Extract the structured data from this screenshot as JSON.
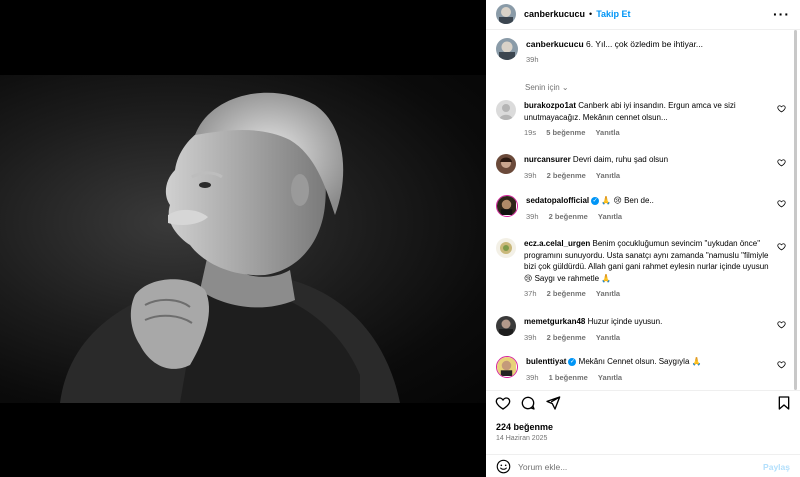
{
  "post": {
    "username": "canberkucucu",
    "dot": "•",
    "follow_label": "Takip Et",
    "more_label": "···",
    "caption": " 6. Yıl... çok özledim be ihtiyar...",
    "caption_time": "39h"
  },
  "sort_label": "Senin için ⌄",
  "comments": [
    {
      "username": "burakozpo1at",
      "text": " Canberk abi iyi insandın. Ergun amca ve sizi unutmayacağız. Mekânın cennet olsun...",
      "time": "19s",
      "likes": "5 beğenme",
      "reply": "Yanıtla"
    },
    {
      "username": "nurcansurer",
      "text": " Devri daim, ruhu şad olsun",
      "time": "39h",
      "likes": "2 beğenme",
      "reply": "Yanıtla"
    },
    {
      "username": "sedatopalofficial",
      "text": " 🙏 😢  Ben de..",
      "time": "39h",
      "likes": "2 beğenme",
      "reply": "Yanıtla"
    },
    {
      "username": "ecz.a.celal_urgen",
      "text": " Benim çocukluğumun sevincim \"uykudan önce\" programını sunuyordu. Usta sanatçı aynı zamanda \"namuslu \"filmiyle bizi çok güldürdü. Allah gani gani rahmet eylesin nurlar içinde uyusun 😢  Saygı ve rahmetle 🙏",
      "time": "37h",
      "likes": "2 beğenme",
      "reply": "Yanıtla"
    },
    {
      "username": "memetgurkan48",
      "text": " Huzur içinde uyusun.",
      "time": "39h",
      "likes": "2 beğenme",
      "reply": "Yanıtla"
    },
    {
      "username": "bulenttiyat",
      "text": " Mekânı Cennet olsun. Saygıyla 🙏",
      "time": "39h",
      "likes": "1 beğenme",
      "reply": "Yanıtla"
    }
  ],
  "verified_mark": "✓",
  "likes_label": "224 beğenme",
  "date_label": "14 Haziran 2025",
  "composer": {
    "placeholder": "Yorum ekle...",
    "post_label": "Paylaş"
  },
  "icons": {
    "like": "heart-icon",
    "comment": "comment-icon",
    "share": "share-icon",
    "save": "bookmark-icon",
    "emoji": "emoji-icon",
    "more": "more-icon"
  },
  "colors": {
    "link_blue": "#0095f6",
    "muted_gray": "#737373",
    "post_disabled": "#b2dffc"
  }
}
